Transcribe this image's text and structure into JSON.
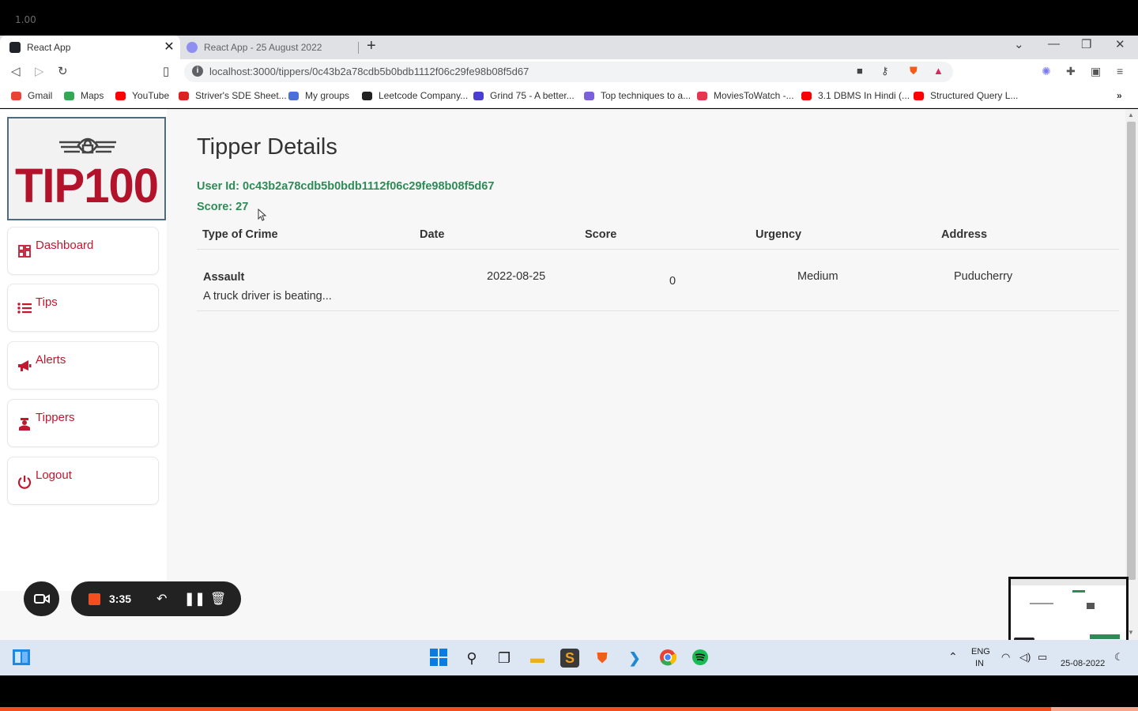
{
  "recorder": {
    "zoom": "1.00",
    "time": "3:35"
  },
  "browser": {
    "tabs": [
      {
        "label": "React App",
        "active": true
      },
      {
        "label": "React App - 25 August 2022",
        "active": false
      }
    ],
    "url": "localhost:3000/tippers/0c43b2a78cdb5b0bdb1112f06c29fe98b08f5d67",
    "bookmarks": [
      {
        "label": "Gmail",
        "color": "#ea4335"
      },
      {
        "label": "Maps",
        "color": "#34a853"
      },
      {
        "label": "YouTube",
        "color": "#ff0000"
      },
      {
        "label": "Striver's SDE Sheet...",
        "color": "#e02020"
      },
      {
        "label": "My groups",
        "color": "#4a6fd8"
      },
      {
        "label": "Leetcode Company...",
        "color": "#222222"
      },
      {
        "label": "Grind 75 - A better...",
        "color": "#4b3fd1"
      },
      {
        "label": "Top techniques to a...",
        "color": "#7b61d9"
      },
      {
        "label": "MoviesToWatch -...",
        "color": "#e8344e"
      },
      {
        "label": "3.1 DBMS In Hindi (...",
        "color": "#ff0000"
      },
      {
        "label": "Structured Query L...",
        "color": "#ff0000"
      }
    ]
  },
  "sidebar": {
    "logo_text": "TIP100",
    "items": [
      {
        "label": "Dashboard",
        "icon": "dashboard-icon"
      },
      {
        "label": "Tips",
        "icon": "list-icon"
      },
      {
        "label": "Alerts",
        "icon": "megaphone-icon"
      },
      {
        "label": "Tippers",
        "icon": "tipper-icon"
      },
      {
        "label": "Logout",
        "icon": "power-icon"
      }
    ]
  },
  "main": {
    "title": "Tipper Details",
    "user_id": "User Id: 0c43b2a78cdb5b0bdb1112f06c29fe98b08f5d67",
    "score": "Score: 27",
    "columns": [
      "Type of Crime",
      "Date",
      "Score",
      "Urgency",
      "Address"
    ],
    "rows": [
      {
        "crime": "Assault",
        "description": "A truck driver is beating...",
        "date": "2022-08-25",
        "score": "0",
        "urgency": "Medium",
        "address": "Puducherry"
      }
    ]
  },
  "taskbar": {
    "lang": "ENG",
    "region": "IN",
    "date": "25-08-2022"
  },
  "colors": {
    "accent": "#c0182f",
    "success": "#2e8b57",
    "record": "#f24e1e"
  }
}
